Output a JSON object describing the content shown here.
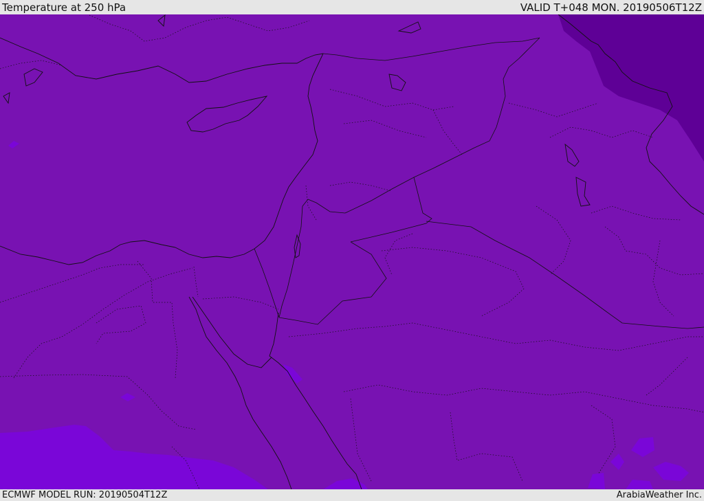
{
  "header": {
    "title": "Temperature at 250 hPa",
    "valid_label": "VALID T+048 MON. 20190506T12Z"
  },
  "footer": {
    "model_run": "ECMWF MODEL RUN: 20190504T12Z",
    "brand": "ArabiaWeather Inc."
  },
  "map": {
    "variable": "Temperature",
    "level": "250 hPa",
    "fill_colors": {
      "base": "#7812b2",
      "cold_core": "#5e0096",
      "warm_patch": "#7a06d8"
    }
  }
}
